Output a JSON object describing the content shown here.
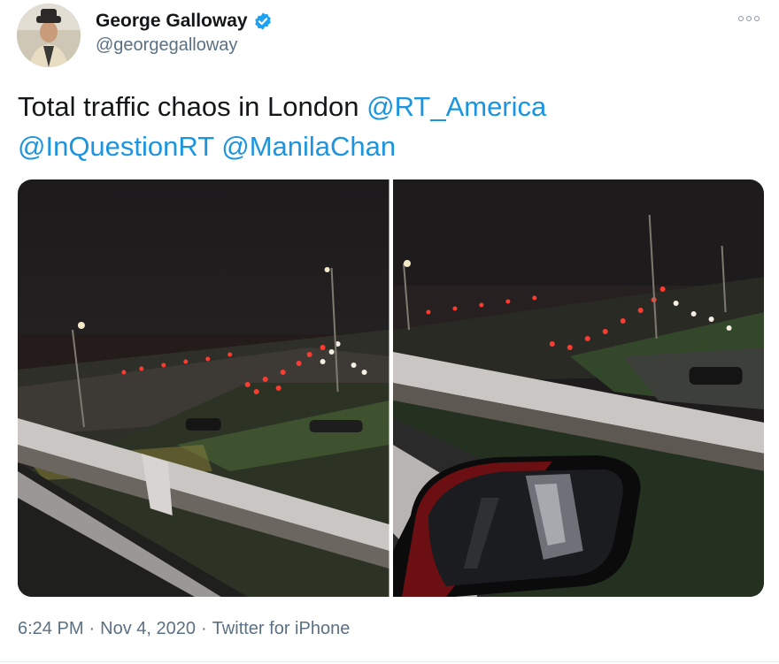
{
  "author": {
    "display_name": "George Galloway",
    "handle": "@georgegalloway",
    "verified": true,
    "verified_color": "#1da1f2"
  },
  "tweet": {
    "text_intro": "Total traffic chaos in London",
    "mentions": [
      "@RT_America",
      "@InQuestionRT",
      "@ManilaChan"
    ],
    "mention_color": "#1b95e0"
  },
  "media": {
    "photos": [
      {
        "icon": "photo-traffic-overpass"
      },
      {
        "icon": "photo-traffic-car-mirror"
      }
    ]
  },
  "meta": {
    "time": "6:24 PM",
    "date": "Nov 4, 2020",
    "source": "Twitter for iPhone",
    "separator": "·"
  },
  "icons": {
    "more": "more-options-icon",
    "verified": "verified-badge-icon"
  }
}
